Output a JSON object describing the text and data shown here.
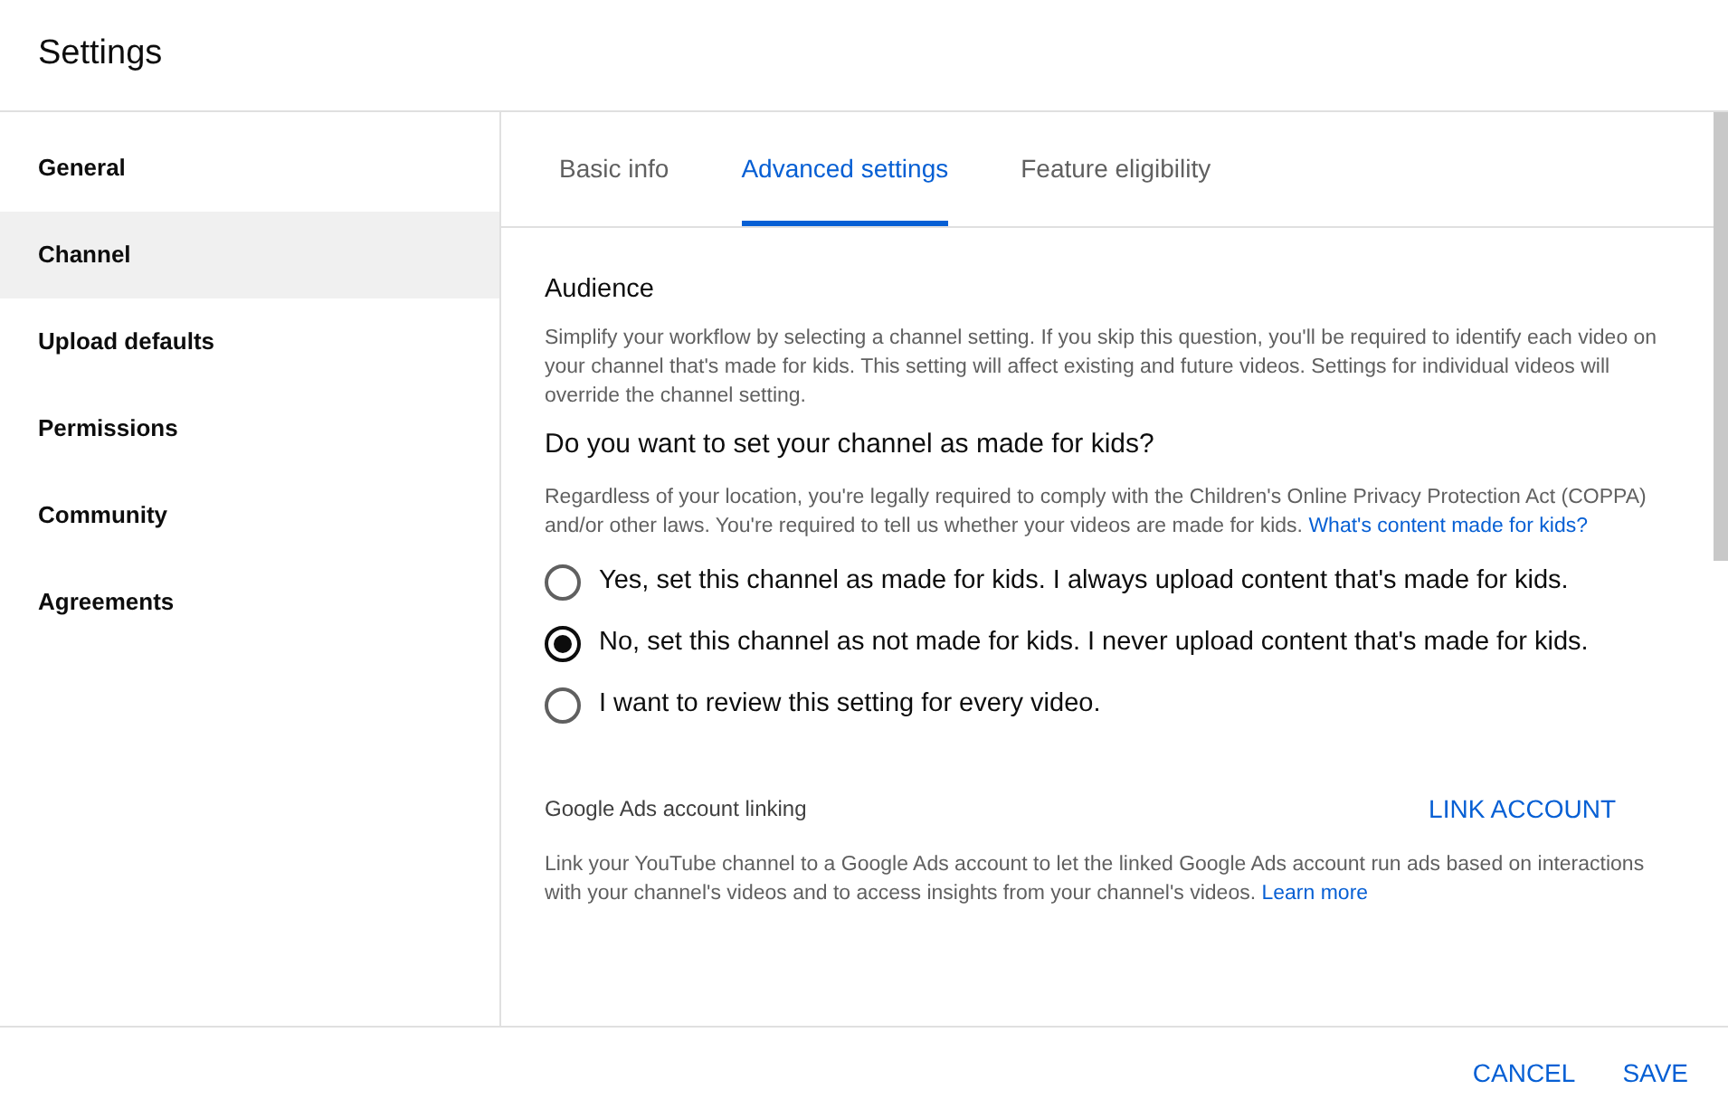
{
  "window": {
    "title": "Settings"
  },
  "sidebar": {
    "items": [
      {
        "label": "General",
        "selected": false
      },
      {
        "label": "Channel",
        "selected": true
      },
      {
        "label": "Upload defaults",
        "selected": false
      },
      {
        "label": "Permissions",
        "selected": false
      },
      {
        "label": "Community",
        "selected": false
      },
      {
        "label": "Agreements",
        "selected": false
      }
    ]
  },
  "tabs": [
    {
      "label": "Basic info",
      "selected": false
    },
    {
      "label": "Advanced settings",
      "selected": true
    },
    {
      "label": "Feature eligibility",
      "selected": false
    }
  ],
  "audience": {
    "heading": "Audience",
    "description": "Simplify your workflow by selecting a channel setting. If you skip this question, you'll be required to identify each video on your channel that's made for kids. This setting will affect existing and future videos. Settings for individual videos will override the channel setting.",
    "question": "Do you want to set your channel as made for kids?",
    "note": {
      "text": "Regardless of your location, you're legally required to comply with the Children's Online Privacy Protection Act (COPPA) and/or other laws. You're required to tell us whether your videos are made for kids.",
      "link": "What's content made for kids?"
    },
    "options": [
      {
        "label": "Yes, set this channel as made for kids. I always upload content that's made for kids.",
        "selected": false
      },
      {
        "label": "No, set this channel as not made for kids. I never upload content that's made for kids.",
        "selected": true
      },
      {
        "label": "I want to review this setting for every video.",
        "selected": false
      }
    ]
  },
  "ads": {
    "heading": "Google Ads account linking",
    "button": "LINK ACCOUNT",
    "description": {
      "text": "Link your YouTube channel to a Google Ads account to let the linked Google Ads account run ads based on interactions with your channel's videos and to access insights from your channel's videos.",
      "link": "Learn more"
    }
  },
  "footer": {
    "buttons": [
      "CANCEL",
      "SAVE"
    ]
  }
}
